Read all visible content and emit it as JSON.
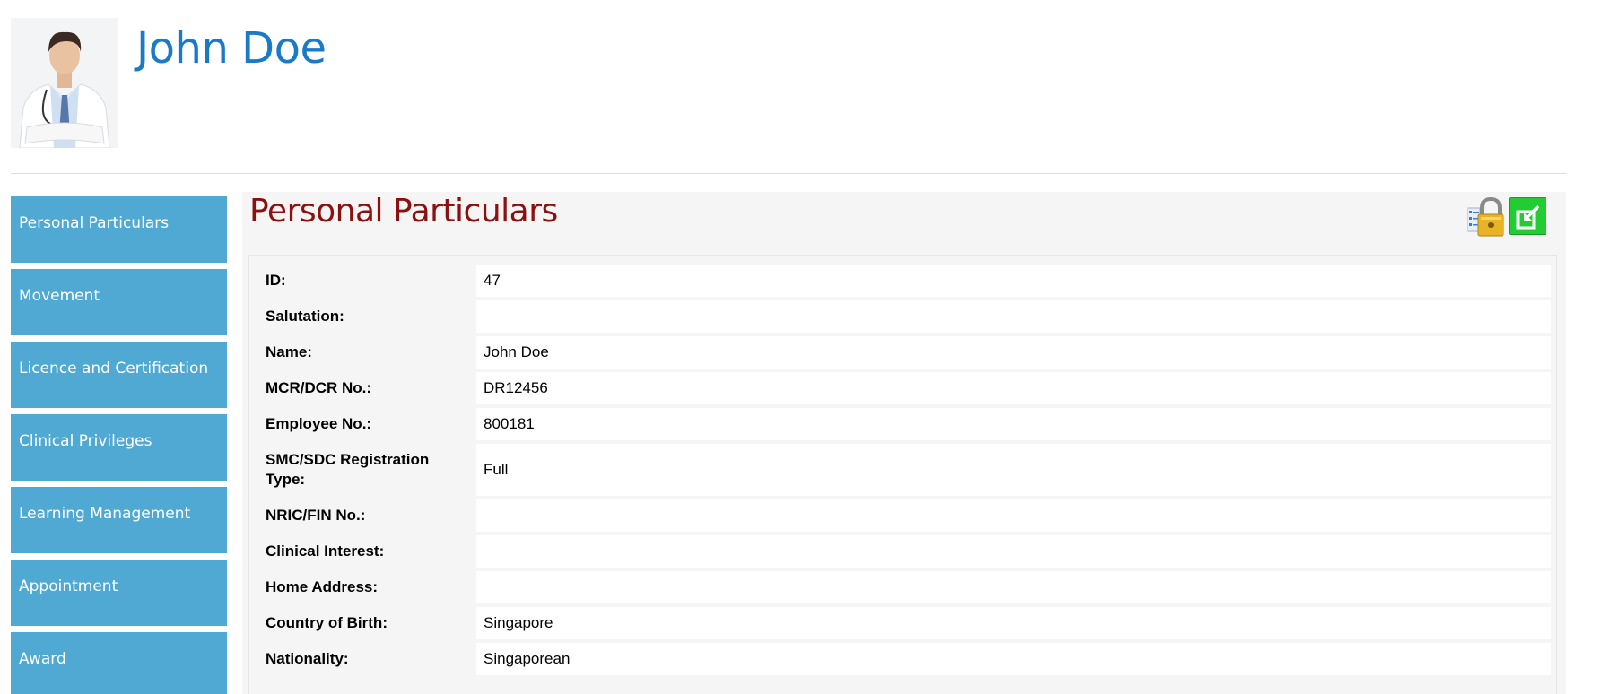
{
  "header": {
    "name": "John Doe"
  },
  "sidebar": {
    "items": [
      {
        "label": "Personal Particulars"
      },
      {
        "label": "Movement"
      },
      {
        "label": "Licence and Certification"
      },
      {
        "label": "Clinical Privileges"
      },
      {
        "label": "Learning Management"
      },
      {
        "label": "Appointment"
      },
      {
        "label": "Award"
      }
    ]
  },
  "panel": {
    "title": "Personal Particulars",
    "lock_icon": "lock-checklist-icon",
    "edit_icon": "edit-export-icon",
    "fields": [
      {
        "label": "ID:",
        "value": "47"
      },
      {
        "label": "Salutation:",
        "value": ""
      },
      {
        "label": "Name:",
        "value": "John Doe"
      },
      {
        "label": "MCR/DCR No.:",
        "value": "DR12456"
      },
      {
        "label": "Employee No.:",
        "value": "800181"
      },
      {
        "label": "SMC/SDC Registration Type:",
        "value": "Full"
      },
      {
        "label": "NRIC/FIN No.:",
        "value": ""
      },
      {
        "label": "Clinical Interest:",
        "value": ""
      },
      {
        "label": "Home Address:",
        "value": ""
      },
      {
        "label": "Country of Birth:",
        "value": "Singapore"
      },
      {
        "label": "Nationality:",
        "value": "Singaporean"
      }
    ]
  },
  "colors": {
    "accent_blue": "#1a7ac8",
    "sidebar_blue": "#4fa9d2",
    "title_red": "#8b1010",
    "edit_green": "#22cc33"
  }
}
